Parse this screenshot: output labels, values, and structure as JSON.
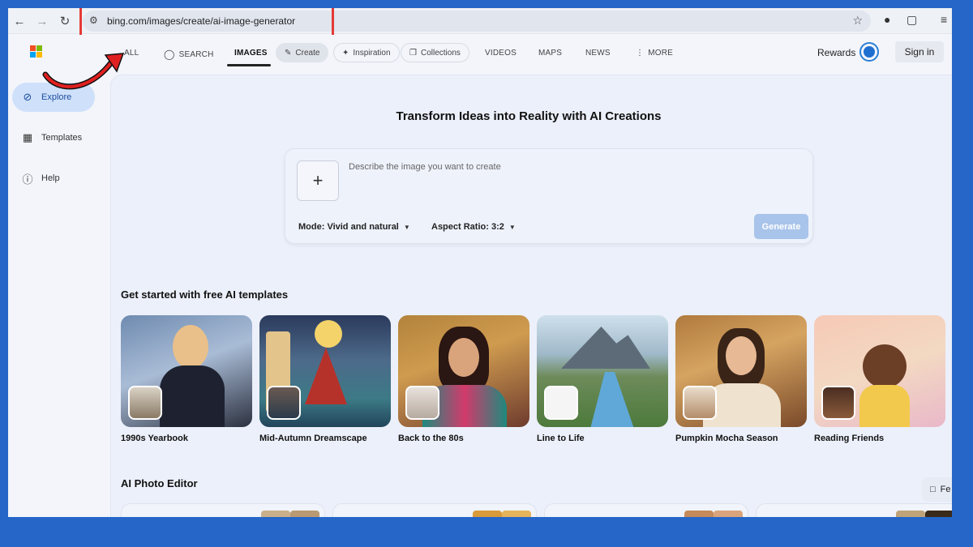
{
  "browser": {
    "url": "bing.com/images/create/ai-image-generator"
  },
  "header": {
    "nav": [
      {
        "label": "ALL"
      },
      {
        "label": "SEARCH"
      },
      {
        "label": "IMAGES"
      },
      {
        "label": "Create"
      },
      {
        "label": "Inspiration"
      },
      {
        "label": "Collections"
      },
      {
        "label": "VIDEOS"
      },
      {
        "label": "MAPS"
      },
      {
        "label": "NEWS"
      },
      {
        "label": "MORE"
      }
    ],
    "rewards": "Rewards",
    "sign_in": "Sign in"
  },
  "sidebar": {
    "items": [
      {
        "label": "Explore",
        "icon": "compass-icon"
      },
      {
        "label": "Templates",
        "icon": "templates-icon"
      },
      {
        "label": "Help",
        "icon": "help-icon"
      }
    ]
  },
  "main": {
    "title": "Transform Ideas into Reality with AI Creations",
    "prompt_placeholder": "Describe the image you want to create",
    "mode": "Mode: Vivid and natural",
    "aspect_ratio": "Aspect Ratio: 3:2",
    "generate": "Generate",
    "templates_title": "Get started with free AI templates",
    "templates": [
      {
        "label": "1990s Yearbook"
      },
      {
        "label": "Mid-Autumn Dreamscape"
      },
      {
        "label": "Back to the 80s"
      },
      {
        "label": "Line to Life"
      },
      {
        "label": "Pumpkin Mocha Season"
      },
      {
        "label": "Reading Friends"
      }
    ],
    "editor_title": "AI Photo Editor",
    "feedback": "Fe"
  },
  "colors": {
    "background": "#2566c8",
    "accent": "#1e6fd0",
    "highlight": "#e53935",
    "generate_disabled": "#a9c4ea"
  }
}
